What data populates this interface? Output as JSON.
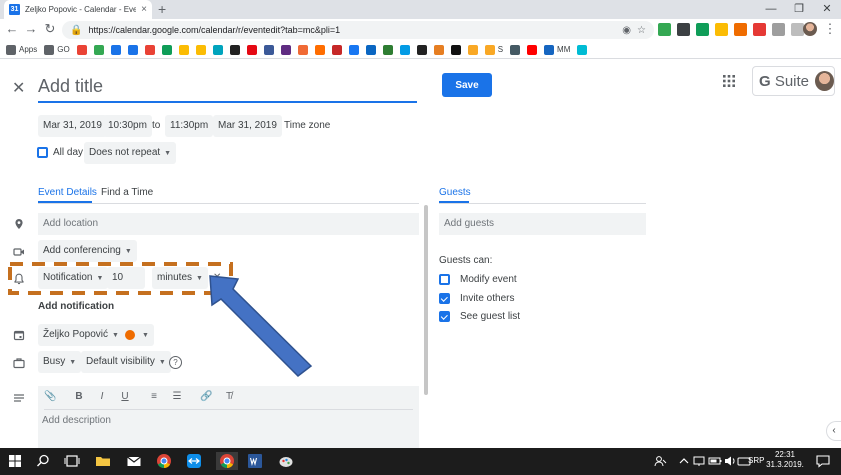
{
  "browser": {
    "tab_title": "Zeljko Popovic - Calendar - Event details",
    "favicon_text": "31",
    "tab_close": "×",
    "new_tab": "+",
    "window_controls": [
      "—",
      "❐",
      "✕"
    ],
    "nav": {
      "back": "←",
      "forward": "→",
      "reload": "↻"
    },
    "url": "https://calendar.google.com/calendar/r/eventedit?tab=mc&pli=1",
    "omnibox_icons": {
      "secure": "🔒",
      "view": "◉",
      "star": "☆"
    },
    "menu_icon": "⋮"
  },
  "bookmarks": [
    {
      "label": "Apps",
      "color": "#5f6368"
    },
    {
      "label": "GO",
      "color": "#5f6368"
    },
    {
      "label": "",
      "color": "#ea4335"
    },
    {
      "label": "",
      "color": "#34a853"
    },
    {
      "label": "",
      "color": "#1a73e8"
    },
    {
      "label": "",
      "color": "#1a73e8"
    },
    {
      "label": "",
      "color": "#e94235"
    },
    {
      "label": "",
      "color": "#0f9d58"
    },
    {
      "label": "",
      "color": "#fbbc04"
    },
    {
      "label": "",
      "color": "#fbbc04"
    },
    {
      "label": "",
      "color": "#00a4bd"
    },
    {
      "label": "",
      "color": "#222222"
    },
    {
      "label": "",
      "color": "#e50914"
    },
    {
      "label": "",
      "color": "#3b5998"
    },
    {
      "label": "",
      "color": "#5f2c82"
    },
    {
      "label": "",
      "color": "#f06a35"
    },
    {
      "label": "",
      "color": "#ff6d00"
    },
    {
      "label": "",
      "color": "#c62828"
    },
    {
      "label": "",
      "color": "#1877f2"
    },
    {
      "label": "",
      "color": "#0a66c2"
    },
    {
      "label": "",
      "color": "#2e7d32"
    },
    {
      "label": "",
      "color": "#039be5"
    },
    {
      "label": "",
      "color": "#222222"
    },
    {
      "label": "",
      "color": "#e67e22"
    },
    {
      "label": "",
      "color": "#111111"
    },
    {
      "label": "",
      "color": "#f9a825"
    },
    {
      "label": "S",
      "color": "#f9a825"
    },
    {
      "label": "",
      "color": "#455a64"
    },
    {
      "label": "",
      "color": "#ff0000"
    },
    {
      "label": "MM",
      "color": "#1565c0"
    },
    {
      "label": "",
      "color": "#00bcd4"
    }
  ],
  "extensions": [
    "#34a853",
    "#3c4043",
    "#0f9d58",
    "#fbbc04",
    "#ef6c00",
    "#e53935",
    "#9e9e9e",
    "#bdbdbd"
  ],
  "event": {
    "close": "✕",
    "title_placeholder": "Add title",
    "save": "Save",
    "start_date": "Mar 31, 2019",
    "start_time": "10:30pm",
    "to": "to",
    "end_time": "11:30pm",
    "end_date": "Mar 31, 2019",
    "timezone": "Time zone",
    "all_day": "All day",
    "repeat": "Does not repeat"
  },
  "gsuite": {
    "text_g": "G",
    "text_suite": " Suite"
  },
  "tabs": {
    "details": "Event Details",
    "find_time": "Find a Time",
    "guests": "Guests"
  },
  "details": {
    "location_placeholder": "Add location",
    "conferencing": "Add conferencing",
    "notification_type": "Notification",
    "notification_value": "10",
    "notification_unit": "minutes",
    "notification_clear": "✕",
    "add_notification": "Add notification",
    "calendar_owner": "Željko Popović",
    "busy": "Busy",
    "visibility": "Default visibility",
    "help": "?",
    "description_placeholder": "Add description",
    "format_buttons": [
      "📎",
      "B",
      "I",
      "U",
      "≡",
      "☰",
      "🔗",
      "T̸"
    ]
  },
  "guests": {
    "placeholder": "Add guests",
    "can_label": "Guests can:",
    "permissions": [
      {
        "label": "Modify event",
        "checked": false
      },
      {
        "label": "Invite others",
        "checked": true
      },
      {
        "label": "See guest list",
        "checked": true
      }
    ]
  },
  "side_panel_toggle": "‹",
  "colors": {
    "accent": "#1a73e8",
    "calendar_color": "#ef6c00",
    "annotation_dash": "#c5701f",
    "annotation_arrow": "#4472c4",
    "annotation_arrow_stroke": "#2f528f"
  },
  "taskbar": {
    "time": "22:31",
    "date": "31.3.2019.",
    "lang": "SRP"
  }
}
